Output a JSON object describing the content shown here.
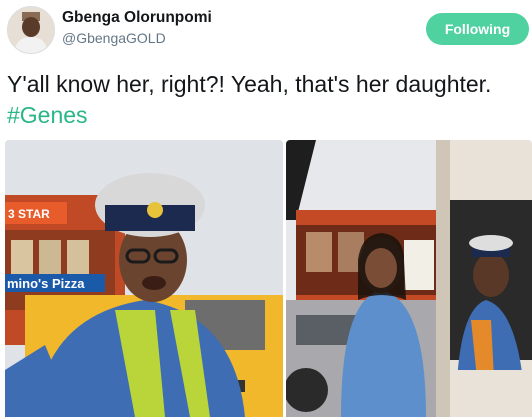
{
  "author": {
    "display_name": "Gbenga Olorunpomi",
    "handle": "@GbengaGOLD"
  },
  "follow_button": {
    "label": "Following"
  },
  "tweet": {
    "text": "Y'all know her, right?! Yeah, that's her daughter. ",
    "hashtag": "#Genes"
  },
  "photos": {
    "left": {
      "sign_text": "mino's Pizza"
    },
    "right": {
      "sign_text": ""
    }
  },
  "colors": {
    "follow_bg": "#4fd1a0",
    "hashtag": "#2ab687"
  }
}
